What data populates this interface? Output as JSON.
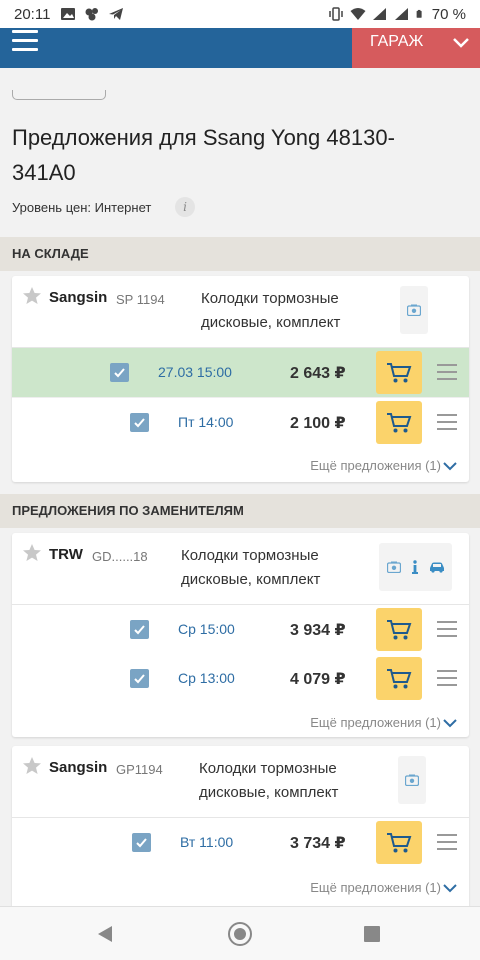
{
  "status_bar": {
    "time": "20:11",
    "battery": "70 %",
    "left_icons": [
      "image-icon",
      "app-icon",
      "telegram-icon"
    ],
    "right_icons": [
      "vibrate-icon",
      "wifi-icon",
      "signal-icon",
      "signal-icon",
      "battery-icon"
    ]
  },
  "app_bar": {
    "garage_label": "ГАРАЖ"
  },
  "page": {
    "title": "Предложения для  Ssang Yong 48130-341A0",
    "price_level": "Уровень цен: Интернет",
    "info_mark": "i"
  },
  "sections": [
    {
      "title": "НА СКЛАДЕ"
    },
    {
      "title": "ПРЕДЛОЖЕНИЯ ПО ЗАМЕНИТЕЛЯМ"
    }
  ],
  "cards": [
    {
      "brand": "Sangsin",
      "code": "SP 1194",
      "description": "Колодки тормозные дисковые, комплект",
      "icons": [
        "photo-icon"
      ],
      "offers": [
        {
          "delivery": "27.03 15:00",
          "price": "2 643 ₽",
          "highlight": true
        },
        {
          "delivery": "Пт 14:00",
          "price": "2 100 ₽",
          "highlight": false
        }
      ],
      "more_label": "Ещё предложения (1)"
    },
    {
      "brand": "TRW",
      "code": "GD......18",
      "description": "Колодки тормозные дисковые, комплект",
      "icons": [
        "photo-icon",
        "info-icon",
        "car-icon"
      ],
      "offers": [
        {
          "delivery": "Ср 15:00",
          "price": "3 934 ₽",
          "highlight": false
        },
        {
          "delivery": "Ср 13:00",
          "price": "4 079 ₽",
          "highlight": false
        }
      ],
      "more_label": "Ещё предложения (1)"
    },
    {
      "brand": "Sangsin",
      "code": "GP1194",
      "description": "Колодки тормозные дисковые, комплект",
      "icons": [
        "photo-icon"
      ],
      "offers": [
        {
          "delivery": "Вт 11:00",
          "price": "3 734 ₽",
          "highlight": false
        }
      ],
      "more_label": "Ещё предложения (1)"
    }
  ],
  "colors": {
    "app_bar": "#24649a",
    "garage": "#d65b5d",
    "cart": "#fbd36b",
    "highlight_row": "#cde6cb",
    "checkbox": "#7aa4c4",
    "delivery_text": "#2e6da4"
  }
}
